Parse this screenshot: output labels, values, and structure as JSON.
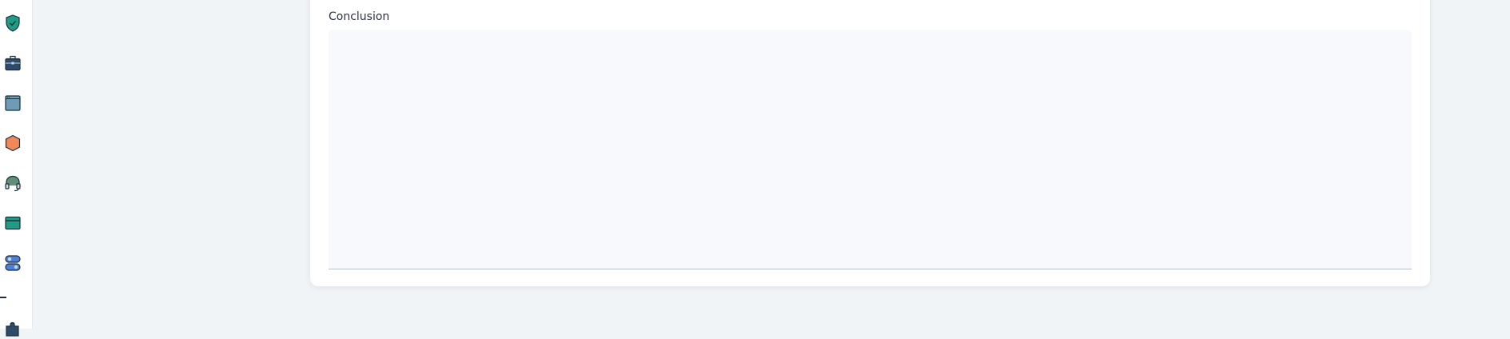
{
  "sidebar": {
    "items": [
      {
        "icon": "shield-icon"
      },
      {
        "icon": "briefcase-icon"
      },
      {
        "icon": "window-icon"
      },
      {
        "icon": "hexagon-icon"
      },
      {
        "icon": "headset-icon"
      },
      {
        "icon": "credit-card-icon"
      },
      {
        "icon": "toggle-stack-icon"
      },
      {
        "icon": "puzzle-icon"
      }
    ]
  },
  "form": {
    "conclusion_label": "Conclusion",
    "conclusion_value": "",
    "conclusion_placeholder": ""
  },
  "colors": {
    "teal": "#1f9b86",
    "navy": "#2d4a6b",
    "slate_blue": "#6f9bb5",
    "orange": "#f0895a",
    "green_gray": "#5f8f78",
    "blue": "#4f7fd8",
    "page_background": "#f1f4f7",
    "field_background": "#f7f9fd"
  }
}
